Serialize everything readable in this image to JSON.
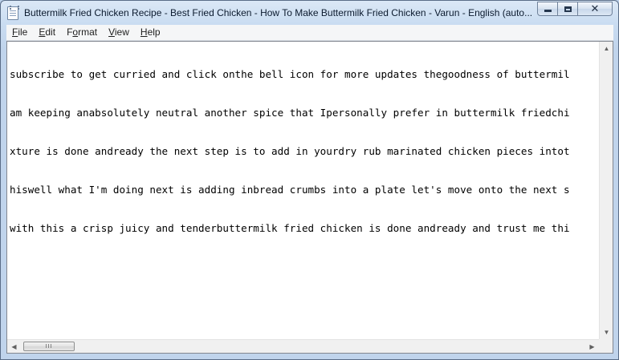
{
  "window": {
    "title": "Buttermilk Fried Chicken Recipe - Best Fried Chicken - How To Make Buttermilk Fried Chicken - Varun - English (auto..."
  },
  "menu": {
    "items": [
      {
        "first": "F",
        "rest": "ile"
      },
      {
        "first": "E",
        "rest": "dit"
      },
      {
        "first": "F",
        "rest": "ormat",
        "underline_first": false,
        "pre": "F",
        "underlined": "o"
      },
      {
        "first": "V",
        "rest": "iew"
      },
      {
        "first": "H",
        "rest": "elp"
      }
    ]
  },
  "document": {
    "lines": [
      "subscribe to get curried and click onthe bell icon for more updates thegoodness of buttermil",
      "am keeping anabsolutely neutral another spice that Ipersonally prefer in buttermilk friedchi",
      "xture is done andready the next step is to add in yourdry rub marinated chicken pieces intot",
      "hiswell what I'm doing next is adding inbread crumbs into a plate let's move onto the next s",
      "with this a crisp juicy and tenderbuttermilk fried chicken is done andready and trust me thi"
    ]
  },
  "scrollbars": {
    "h_thumb_grip": "III"
  },
  "icons": {
    "app": "notepad-icon",
    "minimize": "minimize-icon",
    "maximize": "maximize-icon",
    "close": "close-icon"
  }
}
